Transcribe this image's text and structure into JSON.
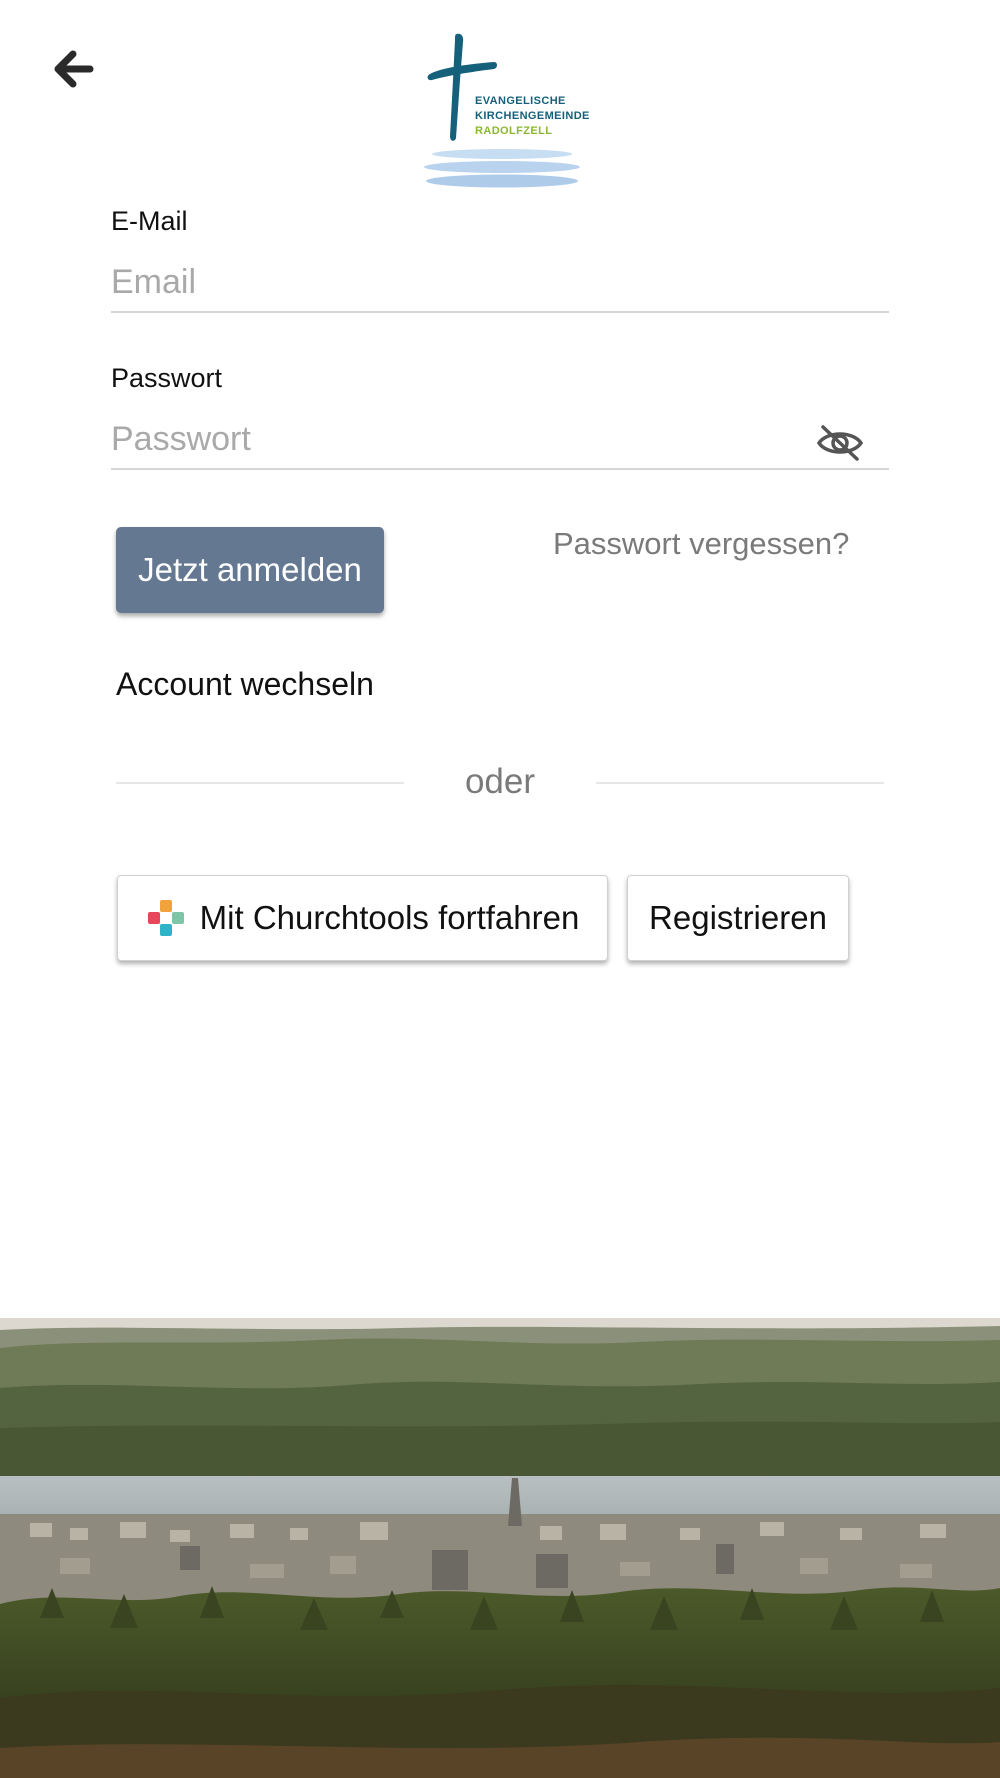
{
  "header": {
    "back_icon": "arrow-left-icon",
    "logo": {
      "line1": "EVANGELISCHE",
      "line2": "KIRCHENGEMEINDE",
      "line3": "RADOLFZELL",
      "colors": {
        "cross": "#15607a",
        "town": "#8bb82f",
        "waves": "#b9d3ee"
      }
    }
  },
  "login_form": {
    "email": {
      "label": "E-Mail",
      "placeholder": "Email",
      "value": ""
    },
    "password": {
      "label": "Passwort",
      "placeholder": "Passwort",
      "value": "",
      "toggle_icon": "eye-off-icon"
    },
    "submit_label": "Jetzt anmelden",
    "forgot_label": "Passwort vergessen?",
    "switch_account_label": "Account wechseln"
  },
  "divider": {
    "text": "oder"
  },
  "alt_actions": {
    "churchtools_label": "Mit Churchtools fortfahren",
    "churchtools_icon": "churchtools-icon",
    "register_label": "Registrieren"
  },
  "colors": {
    "primary_button": "#657892",
    "muted_text": "#7a7a7a",
    "input_border": "#d6d6d6"
  }
}
